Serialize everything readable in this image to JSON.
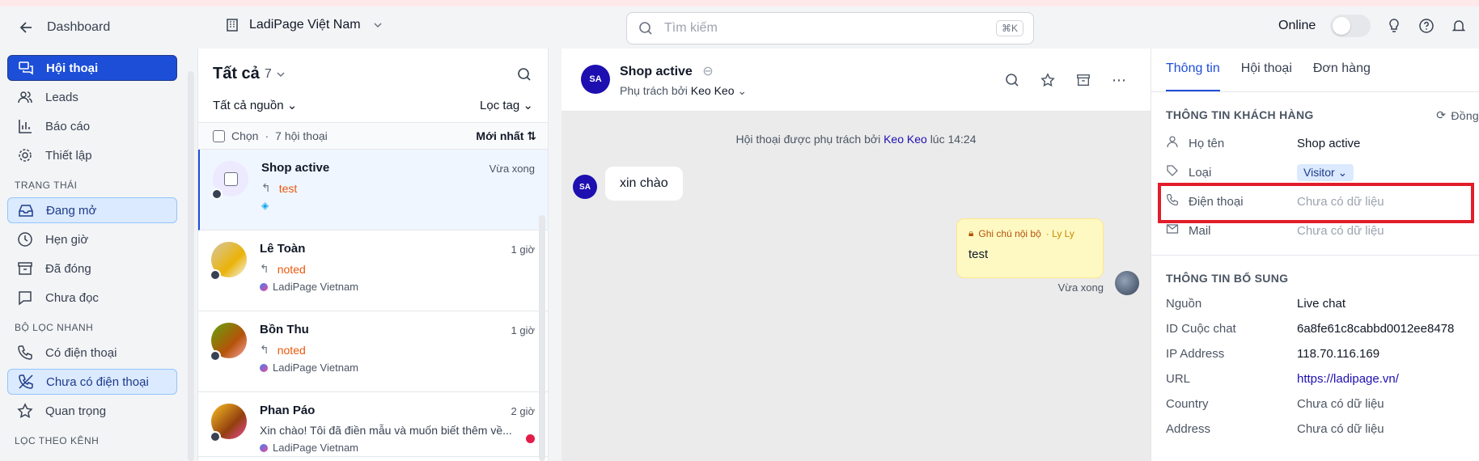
{
  "topbar": {
    "back_label": "Dashboard",
    "workspace": "LadiPage Việt Nam",
    "search_placeholder": "Tìm kiếm",
    "search_shortcut": "⌘K",
    "online_label": "Online"
  },
  "sidebar": {
    "main_items": [
      {
        "label": "Hội thoại"
      },
      {
        "label": "Leads"
      },
      {
        "label": "Báo cáo"
      },
      {
        "label": "Thiết lập"
      }
    ],
    "status_heading": "TRẠNG THÁI",
    "status_items": [
      {
        "label": "Đang mở"
      },
      {
        "label": "Hẹn giờ"
      },
      {
        "label": "Đã đóng"
      },
      {
        "label": "Chưa đọc"
      }
    ],
    "quick_heading": "BỘ LỌC NHANH",
    "quick_items": [
      {
        "label": "Có điện thoại"
      },
      {
        "label": "Chưa có điện thoại"
      },
      {
        "label": "Quan trọng"
      }
    ],
    "channel_heading": "LỌC THEO KÊNH"
  },
  "list": {
    "title": "Tất cả",
    "count": "7",
    "source_filter": "Tất cả nguồn",
    "tag_filter": "Lọc tag",
    "select_label": "Chọn",
    "total_label": "7 hội thoại",
    "sort_label": "Mới nhất",
    "conversations": [
      {
        "name": "Shop active",
        "time": "Vừa xong",
        "message": "test",
        "source": ""
      },
      {
        "name": "Lê Toàn",
        "time": "1 giờ",
        "message": "noted",
        "source": "LadiPage Vietnam"
      },
      {
        "name": "Bồn Thu",
        "time": "1 giờ",
        "message": "noted",
        "source": "LadiPage Vietnam"
      },
      {
        "name": "Phan Páo",
        "time": "2 giờ",
        "message": "Xin chào! Tôi đã điền mẫu và muốn biết thêm về...",
        "source": "LadiPage Vietnam"
      }
    ]
  },
  "chat": {
    "avatar_initials": "SA",
    "name": "Shop active",
    "assigned_prefix": "Phụ trách bởi",
    "assignee": "Keo Keo",
    "system_prefix": "Hội thoại được phụ trách bởi",
    "system_assignee": "Keo Keo",
    "system_time": "lúc 14:24",
    "incoming_message": "xin chào",
    "note_label": "Ghi chú nội bộ",
    "note_author": "· Ly Ly",
    "note_text": "test",
    "note_time": "Vừa xong"
  },
  "info": {
    "tabs": [
      "Thông tin",
      "Hội thoại",
      "Đơn hàng"
    ],
    "customer_heading": "THÔNG TIN KHÁCH HÀNG",
    "sync_label": "Đồng",
    "customer_rows": [
      {
        "label": "Họ tên",
        "value": "Shop active"
      },
      {
        "label": "Loại",
        "value": "Visitor"
      },
      {
        "label": "Điện thoại",
        "value": "Chưa có dữ liệu"
      },
      {
        "label": "Mail",
        "value": "Chưa có dữ liệu"
      }
    ],
    "extra_heading": "THÔNG TIN BỔ SUNG",
    "extra_rows": [
      {
        "label": "Nguồn",
        "value": "Live chat"
      },
      {
        "label": "ID Cuộc chat",
        "value": "6a8fe61c8cabbd0012ee8478"
      },
      {
        "label": "IP Address",
        "value": "118.70.116.169"
      },
      {
        "label": "URL",
        "value": "https://ladipage.vn/"
      },
      {
        "label": "Country",
        "value": "Chưa có dữ liệu"
      },
      {
        "label": "Address",
        "value": "Chưa có dữ liệu"
      }
    ]
  },
  "colors": {
    "accent": "#1d4ed8",
    "highlight_box": "#e11d2a"
  }
}
